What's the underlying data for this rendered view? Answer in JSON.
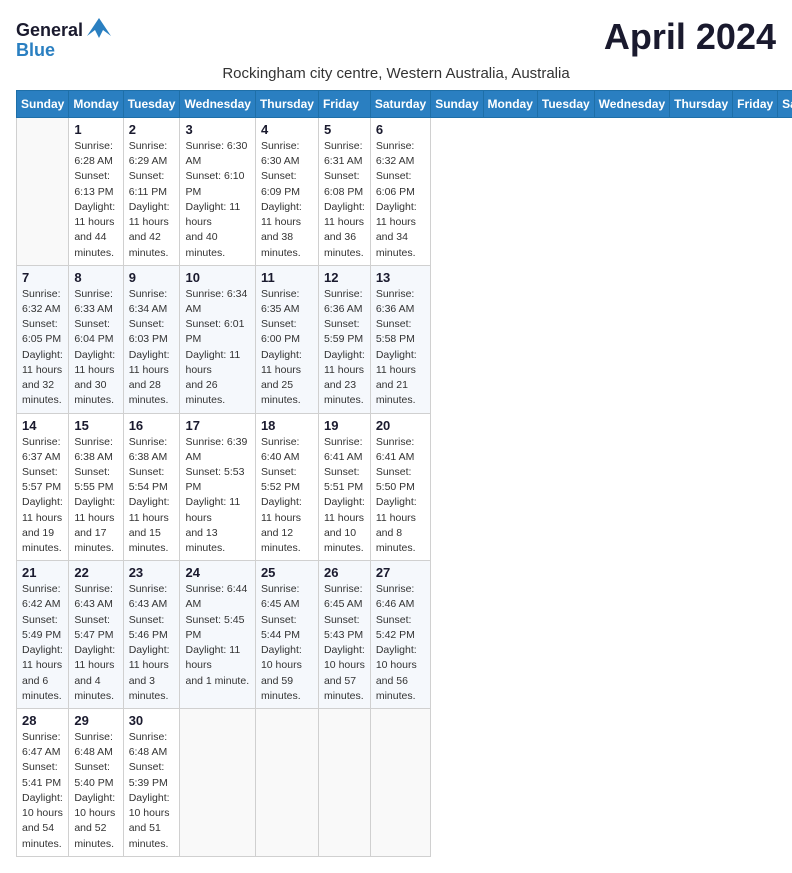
{
  "logo": {
    "line1": "General",
    "line2": "Blue",
    "bird_symbol": "▲"
  },
  "calendar": {
    "month_year": "April 2024",
    "location": "Rockingham city centre, Western Australia, Australia",
    "days_of_week": [
      "Sunday",
      "Monday",
      "Tuesday",
      "Wednesday",
      "Thursday",
      "Friday",
      "Saturday"
    ],
    "weeks": [
      [
        {
          "day": "",
          "info": ""
        },
        {
          "day": "1",
          "info": "Sunrise: 6:28 AM\nSunset: 6:13 PM\nDaylight: 11 hours\nand 44 minutes."
        },
        {
          "day": "2",
          "info": "Sunrise: 6:29 AM\nSunset: 6:11 PM\nDaylight: 11 hours\nand 42 minutes."
        },
        {
          "day": "3",
          "info": "Sunrise: 6:30 AM\nSunset: 6:10 PM\nDaylight: 11 hours\nand 40 minutes."
        },
        {
          "day": "4",
          "info": "Sunrise: 6:30 AM\nSunset: 6:09 PM\nDaylight: 11 hours\nand 38 minutes."
        },
        {
          "day": "5",
          "info": "Sunrise: 6:31 AM\nSunset: 6:08 PM\nDaylight: 11 hours\nand 36 minutes."
        },
        {
          "day": "6",
          "info": "Sunrise: 6:32 AM\nSunset: 6:06 PM\nDaylight: 11 hours\nand 34 minutes."
        }
      ],
      [
        {
          "day": "7",
          "info": "Sunrise: 6:32 AM\nSunset: 6:05 PM\nDaylight: 11 hours\nand 32 minutes."
        },
        {
          "day": "8",
          "info": "Sunrise: 6:33 AM\nSunset: 6:04 PM\nDaylight: 11 hours\nand 30 minutes."
        },
        {
          "day": "9",
          "info": "Sunrise: 6:34 AM\nSunset: 6:03 PM\nDaylight: 11 hours\nand 28 minutes."
        },
        {
          "day": "10",
          "info": "Sunrise: 6:34 AM\nSunset: 6:01 PM\nDaylight: 11 hours\nand 26 minutes."
        },
        {
          "day": "11",
          "info": "Sunrise: 6:35 AM\nSunset: 6:00 PM\nDaylight: 11 hours\nand 25 minutes."
        },
        {
          "day": "12",
          "info": "Sunrise: 6:36 AM\nSunset: 5:59 PM\nDaylight: 11 hours\nand 23 minutes."
        },
        {
          "day": "13",
          "info": "Sunrise: 6:36 AM\nSunset: 5:58 PM\nDaylight: 11 hours\nand 21 minutes."
        }
      ],
      [
        {
          "day": "14",
          "info": "Sunrise: 6:37 AM\nSunset: 5:57 PM\nDaylight: 11 hours\nand 19 minutes."
        },
        {
          "day": "15",
          "info": "Sunrise: 6:38 AM\nSunset: 5:55 PM\nDaylight: 11 hours\nand 17 minutes."
        },
        {
          "day": "16",
          "info": "Sunrise: 6:38 AM\nSunset: 5:54 PM\nDaylight: 11 hours\nand 15 minutes."
        },
        {
          "day": "17",
          "info": "Sunrise: 6:39 AM\nSunset: 5:53 PM\nDaylight: 11 hours\nand 13 minutes."
        },
        {
          "day": "18",
          "info": "Sunrise: 6:40 AM\nSunset: 5:52 PM\nDaylight: 11 hours\nand 12 minutes."
        },
        {
          "day": "19",
          "info": "Sunrise: 6:41 AM\nSunset: 5:51 PM\nDaylight: 11 hours\nand 10 minutes."
        },
        {
          "day": "20",
          "info": "Sunrise: 6:41 AM\nSunset: 5:50 PM\nDaylight: 11 hours\nand 8 minutes."
        }
      ],
      [
        {
          "day": "21",
          "info": "Sunrise: 6:42 AM\nSunset: 5:49 PM\nDaylight: 11 hours\nand 6 minutes."
        },
        {
          "day": "22",
          "info": "Sunrise: 6:43 AM\nSunset: 5:47 PM\nDaylight: 11 hours\nand 4 minutes."
        },
        {
          "day": "23",
          "info": "Sunrise: 6:43 AM\nSunset: 5:46 PM\nDaylight: 11 hours\nand 3 minutes."
        },
        {
          "day": "24",
          "info": "Sunrise: 6:44 AM\nSunset: 5:45 PM\nDaylight: 11 hours\nand 1 minute."
        },
        {
          "day": "25",
          "info": "Sunrise: 6:45 AM\nSunset: 5:44 PM\nDaylight: 10 hours\nand 59 minutes."
        },
        {
          "day": "26",
          "info": "Sunrise: 6:45 AM\nSunset: 5:43 PM\nDaylight: 10 hours\nand 57 minutes."
        },
        {
          "day": "27",
          "info": "Sunrise: 6:46 AM\nSunset: 5:42 PM\nDaylight: 10 hours\nand 56 minutes."
        }
      ],
      [
        {
          "day": "28",
          "info": "Sunrise: 6:47 AM\nSunset: 5:41 PM\nDaylight: 10 hours\nand 54 minutes."
        },
        {
          "day": "29",
          "info": "Sunrise: 6:48 AM\nSunset: 5:40 PM\nDaylight: 10 hours\nand 52 minutes."
        },
        {
          "day": "30",
          "info": "Sunrise: 6:48 AM\nSunset: 5:39 PM\nDaylight: 10 hours\nand 51 minutes."
        },
        {
          "day": "",
          "info": ""
        },
        {
          "day": "",
          "info": ""
        },
        {
          "day": "",
          "info": ""
        },
        {
          "day": "",
          "info": ""
        }
      ]
    ]
  }
}
